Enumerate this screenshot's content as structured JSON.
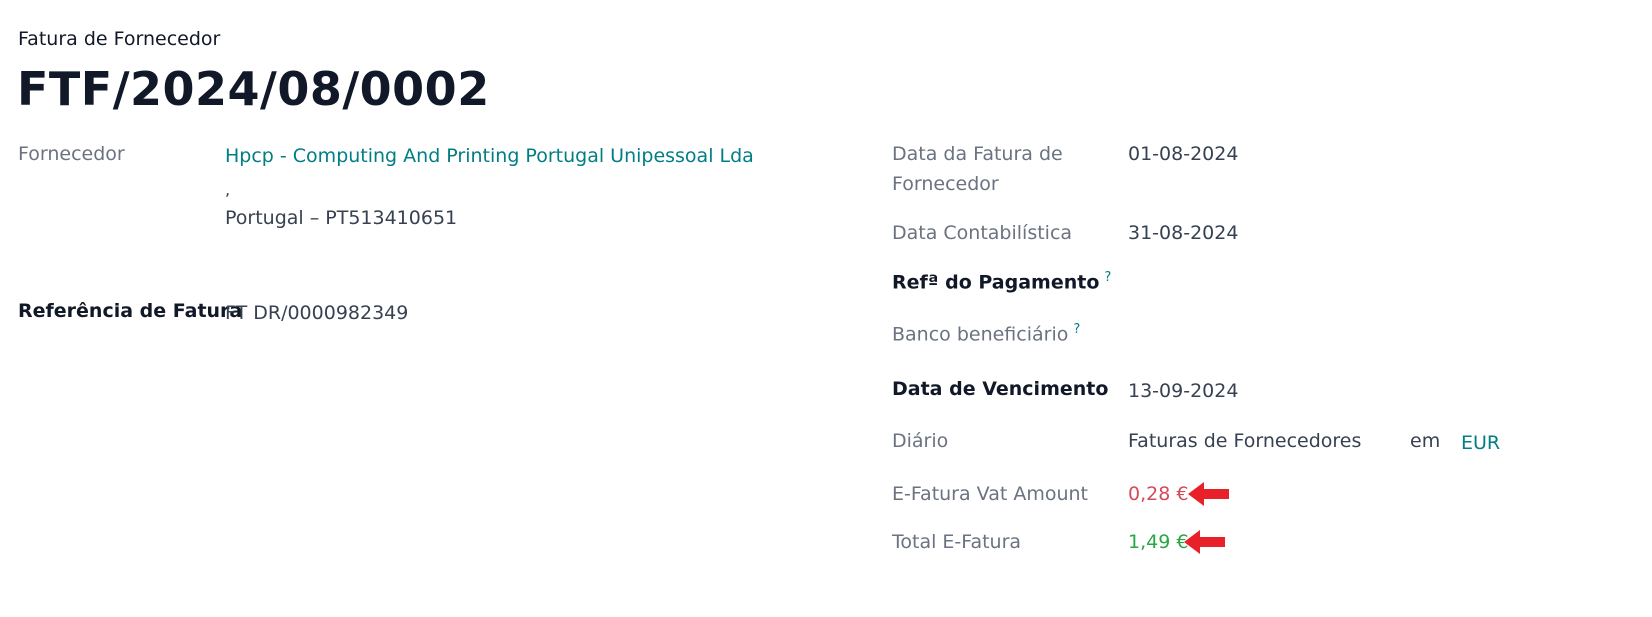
{
  "header": {
    "document_type": "Fatura de Fornecedor",
    "document_number": "FTF/2024/08/0002"
  },
  "left": {
    "vendor_label": "Fornecedor",
    "vendor_name": "Hpcp - Computing And Printing Portugal Unipessoal Lda",
    "vendor_comma": ",",
    "vendor_country_vat": "Portugal – PT513410651",
    "bill_reference_label": "Referência de Fatura",
    "bill_reference_value": "FT DR/0000982349"
  },
  "right": {
    "bill_date_label_1": "Data da Fatura de",
    "bill_date_label_2": "Fornecedor",
    "bill_date_value": "01-08-2024",
    "accounting_date_label": "Data Contabilística",
    "accounting_date_value": "31-08-2024",
    "payment_ref_label": "Refª do Pagamento",
    "payment_ref_tooltip": "?",
    "recipient_bank_label": "Banco beneficiário",
    "recipient_bank_tooltip": "?",
    "due_date_label": "Data de Vencimento",
    "due_date_value": "13-09-2024",
    "journal_label": "Diário",
    "journal_value": "Faturas de Fornecedores",
    "journal_in": "em",
    "currency": "EUR",
    "efatura_vat_label": "E-Fatura Vat Amount",
    "efatura_vat_value": "0,28 €",
    "efatura_total_label": "Total E-Fatura",
    "efatura_total_value": "1,49 €"
  },
  "colors": {
    "link": "#017e84",
    "vat_amount": "#d44c59",
    "total_amount": "#28a745",
    "annotation_arrow": "#e8202a"
  },
  "icons": {
    "annotation": "red-arrow-left-icon"
  }
}
